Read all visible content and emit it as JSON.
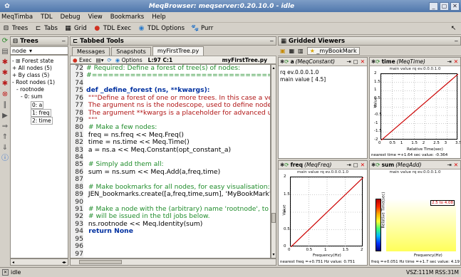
{
  "window": {
    "title": "MeqBrowser: meqserver:0.20.10.0 - idle",
    "buttons": [
      "_",
      "▢",
      "✕"
    ]
  },
  "menubar": {
    "items": [
      "MeqTimba",
      "TDL",
      "Debug",
      "View",
      "Bookmarks",
      "Help"
    ]
  },
  "toolbar": {
    "items": [
      "Trees",
      "Tabs",
      "Grid",
      "TDL Exec",
      "TDL Options",
      "Purr"
    ]
  },
  "trees": {
    "title": "Trees",
    "selector": "node",
    "items": [
      "Forest state",
      "All nodes (5)",
      "By class (5)",
      "Root nodes (1)",
      "rootnode",
      "0: sum",
      "0: a",
      "1: freq",
      "2: time"
    ]
  },
  "tabbed_tools": {
    "title": "Tabbed Tools",
    "tabs": [
      "Messages",
      "Snapshots",
      "myFirstTree.py"
    ],
    "editor_toolbar": {
      "exec": "Exec",
      "options": "Options",
      "position": "L:97 C:1",
      "filename": "myFirstTree.py"
    },
    "code_lines": [
      {
        "num": "72",
        "text": "# Required: Define a forest of tree(s) of nodes:"
      },
      {
        "num": "73",
        "text": "#============================================"
      },
      {
        "num": "74",
        "text": ""
      },
      {
        "num": "75",
        "text": "def _define_forest (ns, **kwargs):"
      },
      {
        "num": "76",
        "text": "   \"\"\"Define a forest of one or more trees. In this case a very"
      },
      {
        "num": "77",
        "text": "   The argument ns is the nodescope, used to define nodes."
      },
      {
        "num": "78",
        "text": "   The argument **kwargs is a placeholder for advanced use"
      },
      {
        "num": "79",
        "text": "   \"\"\""
      },
      {
        "num": "80",
        "text": "   # Make a few nodes:"
      },
      {
        "num": "81",
        "text": "   freq = ns.freq << Meq.Freq()"
      },
      {
        "num": "82",
        "text": "   time = ns.time << Meq.Time()"
      },
      {
        "num": "83",
        "text": "   a = ns.a << Meq.Constant(opt_constant_a)"
      },
      {
        "num": "84",
        "text": ""
      },
      {
        "num": "85",
        "text": "   # Simply add them all:"
      },
      {
        "num": "86",
        "text": "   sum = ns.sum << Meq.Add(a,freq,time)"
      },
      {
        "num": "87",
        "text": ""
      },
      {
        "num": "88",
        "text": "   # Make bookmarks for all nodes, for easy visualisation:"
      },
      {
        "num": "89",
        "text": "   JEN_bookmarks.create([a,freq,time,sum], 'MyBookMark')"
      },
      {
        "num": "90",
        "text": ""
      },
      {
        "num": "91",
        "text": "   # Make a node with the (arbitrary) name 'rootnode', to wh"
      },
      {
        "num": "92",
        "text": "   # will be issued in the tdl jobs below."
      },
      {
        "num": "93",
        "text": "   ns.rootnode << Meq.Identity(sum)"
      },
      {
        "num": "94",
        "text": "   return None"
      },
      {
        "num": "95",
        "text": ""
      },
      {
        "num": "96",
        "text": ""
      },
      {
        "num": "97",
        "text": ""
      }
    ]
  },
  "gridded_viewers": {
    "title": "Gridded Viewers",
    "bookmark": "_myBookMark",
    "cells": [
      {
        "name": "a",
        "class": "(MeqConstant)",
        "lines": [
          "rq ev.0.0.0.1.0",
          "main value  [ 4.5]"
        ]
      },
      {
        "name": "time",
        "class": "(MeqTime)",
        "plot_title": "main value  rq ev.0.0.0.1.0",
        "ylabel": "Value",
        "xlabel": "Relative Time(sec)",
        "footer": "nearest time =+1.64 sec  value: -0.364",
        "xticks": [
          "0",
          "0.5",
          "1",
          "1.5",
          "2",
          "2.5",
          "3",
          "3.5"
        ],
        "yticks": [
          "2",
          "1.5",
          "1",
          "0.5",
          "0",
          "-0.5",
          "-1",
          "-1.5",
          "-2"
        ]
      },
      {
        "name": "freq",
        "class": "(MeqFreq)",
        "plot_title": "main value  rq ev.0.0.0.1.0",
        "ylabel": "Value",
        "xlabel": "Frequency(Hz)",
        "footer": "nearest freq =+0.751 Hz  value: 0.751",
        "xticks": [
          "0",
          "0.5",
          "1",
          "1.5",
          "2"
        ],
        "yticks": [
          "2",
          "1.5",
          "1",
          "0.5",
          "0"
        ]
      },
      {
        "name": "sum",
        "class": "(MeqAdd)",
        "plot_title": "main value  rq ev.0.0.0.1.0",
        "ylabel": "Relative Time(sec)",
        "xlabel": "Frequency(Hz)",
        "footer": "freq =+0.051 Hz  time =+1.7 sec value: 4.19",
        "legend": "2.5 to 4.08",
        "xticks": [
          "0.5",
          "1",
          "1.5"
        ]
      }
    ]
  },
  "statusbar": {
    "text": "idle",
    "stats": "VSZ:111M RSS:31M"
  },
  "colors": {
    "comment": "#1f8c2a",
    "string": "#b01515",
    "keyword": "#0030a0",
    "plot_line": "#cc0000",
    "title_bar": "#4f77ac"
  }
}
